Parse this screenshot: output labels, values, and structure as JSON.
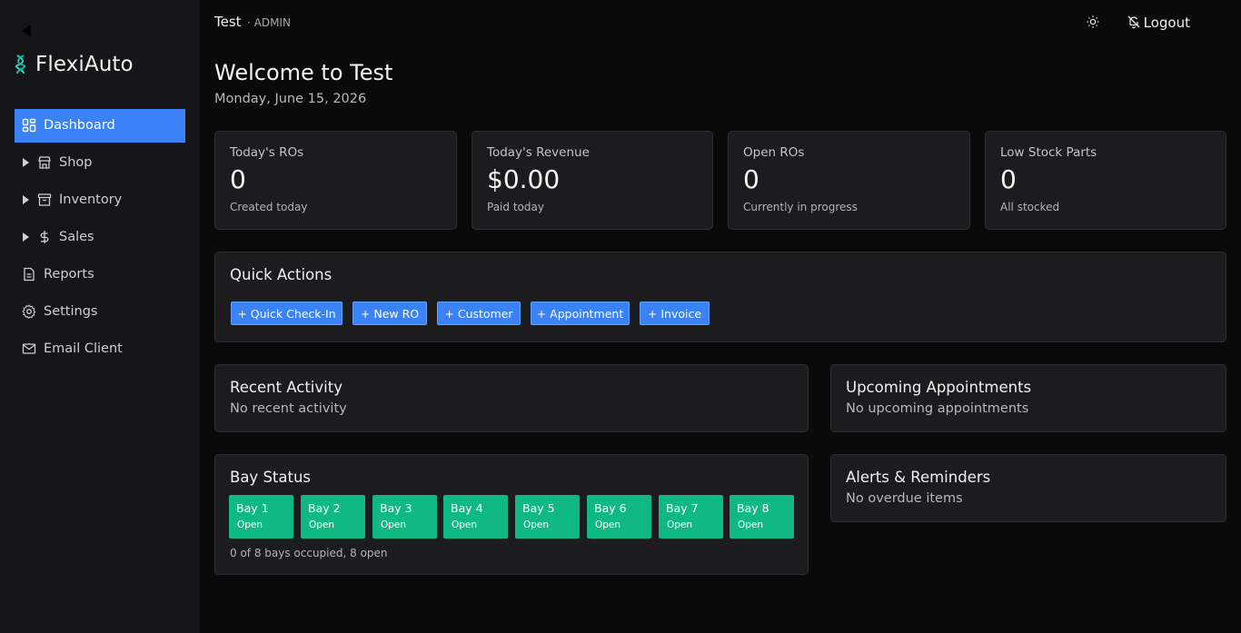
{
  "sidebar": {
    "brand": "FlexiAuto",
    "items": [
      {
        "label": "Dashboard",
        "icon": "dashboard-icon"
      },
      {
        "label": "Shop",
        "icon": "store-icon"
      },
      {
        "label": "Inventory",
        "icon": "archive-icon"
      },
      {
        "label": "Sales",
        "icon": "dollar-icon"
      },
      {
        "label": "Reports",
        "icon": "document-icon"
      },
      {
        "label": "Settings",
        "icon": "gear-icon"
      },
      {
        "label": "Email Client",
        "icon": "mail-icon"
      }
    ]
  },
  "header": {
    "org": "Test",
    "role": "· ADMIN",
    "logout": "Logout",
    "theme_icon": "sun-icon",
    "notification_icon": "bell-off-icon"
  },
  "main": {
    "welcome": "Welcome to Test",
    "date": "Monday, June 15, 2026",
    "stats": [
      {
        "label": "Today's ROs",
        "value": "0",
        "sub": "Created today"
      },
      {
        "label": "Today's Revenue",
        "value": "$0.00",
        "sub": "Paid today"
      },
      {
        "label": "Open ROs",
        "value": "0",
        "sub": "Currently in progress"
      },
      {
        "label": "Low Stock Parts",
        "value": "0",
        "sub": "All stocked"
      }
    ],
    "quick_actions": {
      "title": "Quick Actions",
      "buttons": [
        "+ Quick Check-In",
        "+ New RO",
        "+ Customer",
        "+ Appointment",
        "+ Invoice"
      ]
    },
    "recent_activity": {
      "title": "Recent Activity",
      "text": "No recent activity"
    },
    "upcoming": {
      "title": "Upcoming Appointments",
      "text": "No upcoming appointments"
    },
    "bay_status": {
      "title": "Bay Status",
      "bays": [
        {
          "name": "Bay 1",
          "status": "Open"
        },
        {
          "name": "Bay 2",
          "status": "Open"
        },
        {
          "name": "Bay 3",
          "status": "Open"
        },
        {
          "name": "Bay 4",
          "status": "Open"
        },
        {
          "name": "Bay 5",
          "status": "Open"
        },
        {
          "name": "Bay 6",
          "status": "Open"
        },
        {
          "name": "Bay 7",
          "status": "Open"
        },
        {
          "name": "Bay 8",
          "status": "Open"
        }
      ],
      "summary": "0 of 8 bays occupied, 8 open"
    },
    "alerts": {
      "title": "Alerts & Reminders",
      "text": "No overdue items"
    }
  },
  "colors": {
    "accent": "#3b82f6",
    "bay_open": "#10b981",
    "brand_icon": "#2dd4bf"
  }
}
